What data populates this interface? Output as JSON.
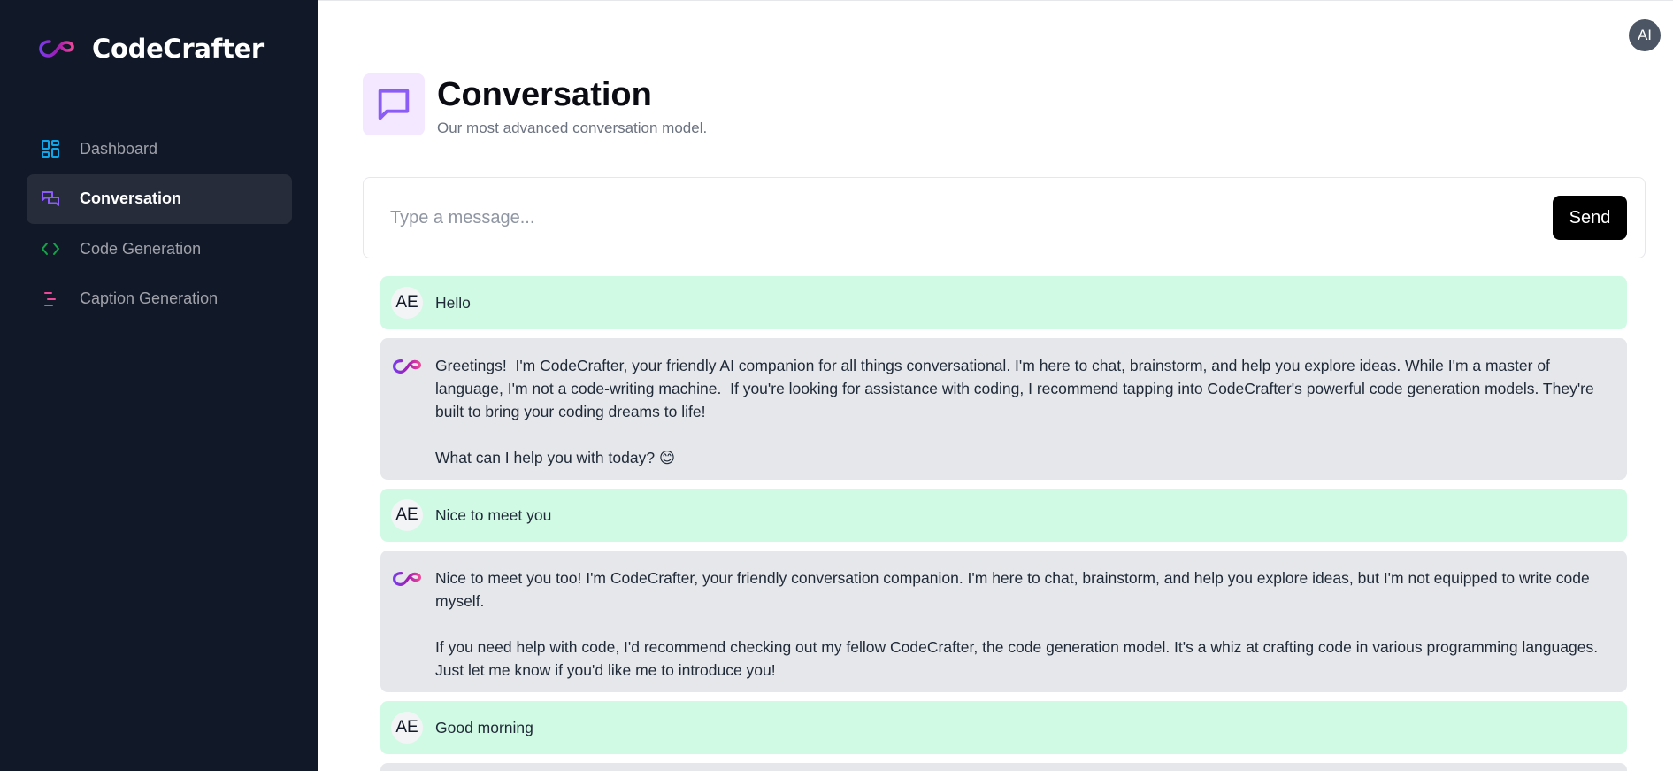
{
  "app": {
    "name": "CodeCrafter",
    "logo_icon": "infinity-logo-icon",
    "colors": {
      "sidebar_bg": "#111827",
      "active_item_bg": "#262c3a",
      "user_bubble": "#d1fae5",
      "bot_bubble": "#e5e7eb",
      "accent_purple": "#8b5cf6"
    }
  },
  "sidebar": {
    "items": [
      {
        "label": "Dashboard",
        "icon": "dashboard-grid-icon",
        "icon_color": "#0ea5e9",
        "active": false
      },
      {
        "label": "Conversation",
        "icon": "chat-bubbles-icon",
        "icon_color": "#8b5cf6",
        "active": true
      },
      {
        "label": "Code Generation",
        "icon": "code-brackets-icon",
        "icon_color": "#16a34a",
        "active": false
      },
      {
        "label": "Caption Generation",
        "icon": "text-lines-icon",
        "icon_color": "#ec4899",
        "active": false
      }
    ]
  },
  "header": {
    "user_avatar": "AI"
  },
  "page": {
    "title": "Conversation",
    "subtitle": "Our most advanced conversation model.",
    "icon": "message-square-icon"
  },
  "composer": {
    "placeholder": "Type a message...",
    "value": "",
    "send_label": "Send"
  },
  "messages": [
    {
      "role": "user",
      "avatar": "AE",
      "text": "Hello"
    },
    {
      "role": "bot",
      "avatar": "infinity-logo-icon",
      "text": "Greetings!  I'm CodeCrafter, your friendly AI companion for all things conversational. I'm here to chat, brainstorm, and help you explore ideas. While I'm a master of language, I'm not a code-writing machine.  If you're looking for assistance with coding, I recommend tapping into CodeCrafter's powerful code generation models. They're built to bring your coding dreams to life!\n\nWhat can I help you with today? 😊"
    },
    {
      "role": "user",
      "avatar": "AE",
      "text": "Nice to meet you"
    },
    {
      "role": "bot",
      "avatar": "infinity-logo-icon",
      "text": "Nice to meet you too! I'm CodeCrafter, your friendly conversation companion. I'm here to chat, brainstorm, and help you explore ideas, but I'm not equipped to write code myself.\n\nIf you need help with code, I'd recommend checking out my fellow CodeCrafter, the code generation model. It's a whiz at crafting code in various programming languages. Just let me know if you'd like me to introduce you!"
    },
    {
      "role": "user",
      "avatar": "AE",
      "text": "Good morning"
    }
  ]
}
